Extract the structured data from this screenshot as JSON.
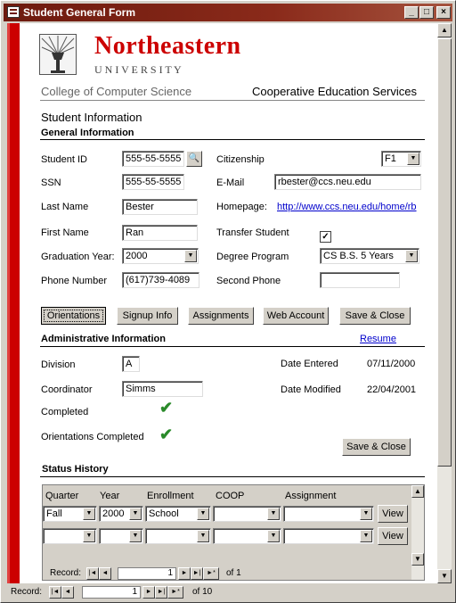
{
  "window": {
    "title": "Student General Form",
    "min": "_",
    "max": "□",
    "close": "×"
  },
  "logo": {
    "name": "Northeastern",
    "sub": "U N I V E R S I T Y"
  },
  "header": {
    "college": "College of Computer Science",
    "service": "Cooperative Education Services",
    "section": "Student Information"
  },
  "general": {
    "title": "General Information",
    "student_id_label": "Student ID",
    "student_id": "555-55-5555",
    "ssn_label": "SSN",
    "ssn": "555-55-5555",
    "last_name_label": "Last Name",
    "last_name": "Bester",
    "first_name_label": "First Name",
    "first_name": "Ran",
    "grad_year_label": "Graduation Year:",
    "grad_year": "2000",
    "phone_label": "Phone Number",
    "phone": "(617)739-4089",
    "citizenship_label": "Citizenship",
    "citizenship": "F1",
    "email_label": "E-Mail",
    "email": "rbester@ccs.neu.edu",
    "homepage_label": "Homepage:",
    "homepage": "http://www.ccs.neu.edu/home/rb",
    "transfer_label": "Transfer Student",
    "transfer_check": "✓",
    "degree_label": "Degree Program",
    "degree": "CS B.S. 5 Years",
    "second_phone_label": "Second Phone",
    "second_phone": ""
  },
  "buttons": {
    "orientations": "Orientations",
    "signup": "Signup Info",
    "assignments": "Assignments",
    "web_account": "Web Account",
    "save_close": "Save & Close"
  },
  "admin": {
    "title": "Administrative Information",
    "resume": "Resume",
    "division_label": "Division",
    "division": "A",
    "coordinator_label": "Coordinator",
    "coordinator": "Simms",
    "completed_label": "Completed",
    "orient_completed_label": "Orientations Completed",
    "date_entered_label": "Date Entered",
    "date_entered": "07/11/2000",
    "date_modified_label": "Date Modified",
    "date_modified": "22/04/2001",
    "save_close": "Save & Close"
  },
  "status": {
    "title": "Status History",
    "columns": [
      "Quarter",
      "Year",
      "Enrollment",
      "COOP",
      "Assignment"
    ],
    "rows": [
      {
        "quarter": "Fall",
        "year": "2000",
        "enrollment": "School",
        "coop": "",
        "assignment": "",
        "view": "View"
      },
      {
        "quarter": "",
        "year": "",
        "enrollment": "",
        "coop": "",
        "assignment": "",
        "view": "View"
      }
    ],
    "record_label": "Record:",
    "record": "1",
    "of": "of  1"
  },
  "main_nav": {
    "record_label": "Record:",
    "record": "1",
    "of": "of  10"
  },
  "icons": {
    "nav_first": "|◄",
    "nav_prev": "◄",
    "nav_next": "►",
    "nav_last": "►|",
    "nav_new": "►*",
    "dropdown": "▼",
    "scroll_up": "▲",
    "scroll_down": "▼"
  }
}
